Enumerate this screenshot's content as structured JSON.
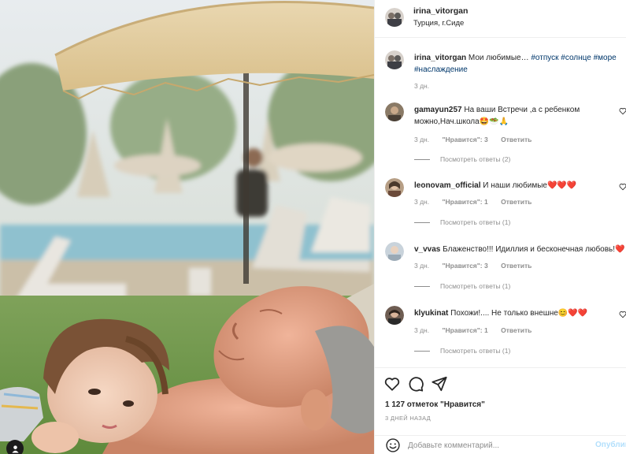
{
  "post": {
    "username": "irina_vitorgan",
    "location": "Турция, г.Сиде",
    "caption": {
      "author": "irina_vitorgan",
      "text": "Мои любимые…",
      "hashtags_line1": "#отпуск #солнце #море",
      "hashtags_line2": "#наслаждение",
      "time": "3 дн."
    },
    "likes": "1 127 отметок \"Нравится\"",
    "posted": "3 ДНЕЙ НАЗАД"
  },
  "comments": [
    {
      "author": "gamayun257",
      "text_line1": "На ваши Встречи ,а с ребенком",
      "text_line2": "можно,Нач.школа🤩🥗🙏",
      "time": "3 дн.",
      "likes": "\"Нравится\": 3",
      "reply": "Ответить",
      "view_replies": "Посмотреть ответы (2)"
    },
    {
      "author": "leonovam_official",
      "text": "И наши любимые❤️❤️❤️",
      "time": "3 дн.",
      "likes": "\"Нравится\": 1",
      "reply": "Ответить",
      "view_replies": "Посмотреть ответы (1)"
    },
    {
      "author": "v_vvas",
      "text": "Блаженство!!! Идиллия и бесконечная любовь!❤️",
      "time": "3 дн.",
      "likes": "\"Нравится\": 3",
      "reply": "Ответить",
      "view_replies": "Посмотреть ответы (1)"
    },
    {
      "author": "klyukinat",
      "text": "Похожи!.... Не только внешне😊❤️❤️",
      "time": "3 дн.",
      "likes": "\"Нравится\": 1",
      "reply": "Ответить",
      "view_replies": "Посмотреть ответы (1)"
    }
  ],
  "add_comment": {
    "placeholder": "Добавьте комментарий...",
    "post_label": "Опубликовать"
  },
  "icons": {
    "like": "heart-icon",
    "comment": "comment-icon",
    "share": "share-icon",
    "emoji": "emoji-icon",
    "tag": "person-icon"
  },
  "colors": {
    "hashtag": "#00376b",
    "muted": "#8e8e8e",
    "post_disabled": "#b2dffc"
  }
}
